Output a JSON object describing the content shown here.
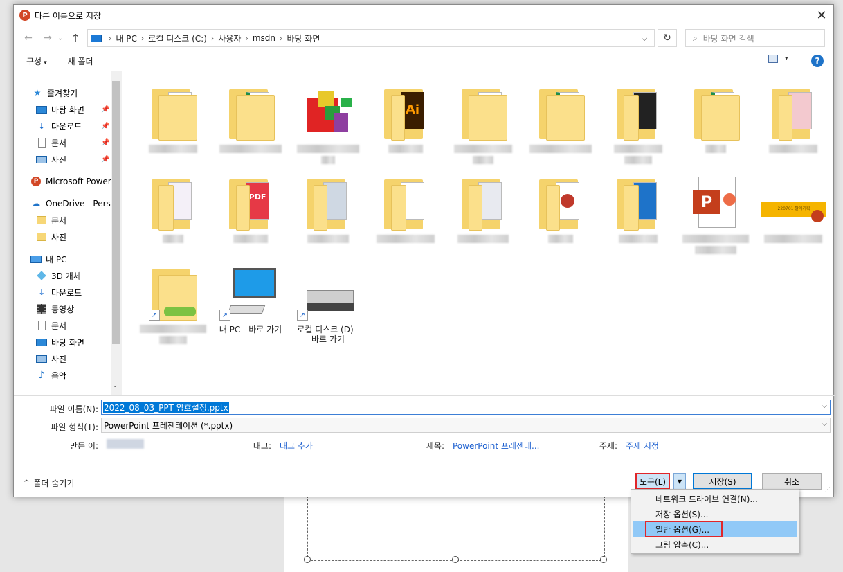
{
  "dialog": {
    "title": "다른 이름으로 저장",
    "app_icon": "P",
    "close_glyph": "✕"
  },
  "nav_buttons": {
    "back": "←",
    "forward": "→",
    "history": "⌄",
    "up": "↑"
  },
  "address": {
    "crumbs": [
      "내 PC",
      "로컬 디스크 (C:)",
      "사용자",
      "msdn",
      "바탕 화면"
    ],
    "separator": "›",
    "dropdown": "⌵",
    "refresh": "↻"
  },
  "search": {
    "icon": "⌕",
    "placeholder": "바탕 화면 검색"
  },
  "toolbar": {
    "organize": "구성",
    "organize_caret": "▾",
    "new_folder": "새 폴더",
    "view_caret": "▾",
    "help": "?"
  },
  "sidebar": {
    "items": [
      {
        "label": "즐겨찾기",
        "icon": "★"
      },
      {
        "label": "바탕 화면",
        "icon": "desktop-icon"
      },
      {
        "label": "다운로드",
        "icon": "↓"
      },
      {
        "label": "문서",
        "icon": "document-icon"
      },
      {
        "label": "사진",
        "icon": "pictures-icon"
      },
      {
        "label": "Microsoft PowerP",
        "icon": "P"
      },
      {
        "label": "OneDrive - Persor",
        "icon": "☁"
      },
      {
        "label": "문서",
        "icon": "folder-icon"
      },
      {
        "label": "사진",
        "icon": "folder-icon"
      },
      {
        "label": "내 PC",
        "icon": "pc-icon"
      },
      {
        "label": "3D 개체",
        "icon": "cube-icon"
      },
      {
        "label": "다운로드",
        "icon": "↓"
      },
      {
        "label": "동영상",
        "icon": "video-icon"
      },
      {
        "label": "문서",
        "icon": "document-icon"
      },
      {
        "label": "바탕 화면",
        "icon": "desktop-icon"
      },
      {
        "label": "사진",
        "icon": "pictures-icon"
      },
      {
        "label": "음악",
        "icon": "♪"
      }
    ],
    "pin": "📌",
    "scroll_down": "⌄"
  },
  "files": {
    "shortcut_glyph": "↗",
    "shortcuts": [
      {
        "label": "내 PC - 바로 가기"
      },
      {
        "label": "로컬 디스크 (D) - 바로 가기"
      }
    ],
    "ppt_glyph": "P",
    "banner_text": "220701 팔레기획"
  },
  "form": {
    "filename_label": "파일 이름(N):",
    "filename_value": "2022_08_03_PPT 암호설정.pptx",
    "filetype_label": "파일 형식(T):",
    "filetype_value": "PowerPoint 프레젠테이션 (*.pptx)",
    "author_label": "만든 이:",
    "tags_label": "태그:",
    "tags_value": "태그 추가",
    "title_label": "제목:",
    "title_value": "PowerPoint 프레젠테...",
    "subject_label": "주제:",
    "subject_value": "주제 지정",
    "dropdown_arrow": "⌵"
  },
  "footer": {
    "hide_folders": "폴더 숨기기",
    "hide_chevron": "^",
    "tools": "도구(L)",
    "tools_caret": "▼",
    "save": "저장(S)",
    "cancel": "취소"
  },
  "tools_menu": [
    "네트워크 드라이브 연결(N)...",
    "저장 옵션(S)...",
    "일반 옵션(G)...",
    "그림 압축(C)..."
  ],
  "colors": {
    "accent": "#0078d7",
    "highlight": "#e0262a",
    "menu_hover": "#91c9f7"
  }
}
